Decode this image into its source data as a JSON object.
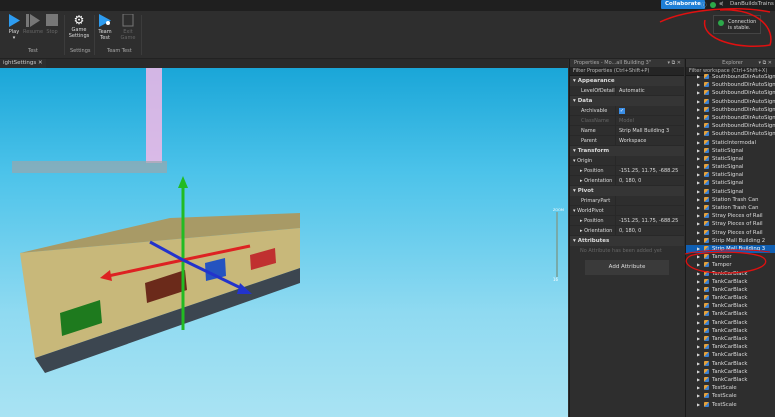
{
  "topbar": {
    "collaborate": "Collaborate",
    "user": "DanBuildsTrains"
  },
  "ribbon": {
    "play": "Play",
    "resume": "Resume",
    "stop": "Stop",
    "game_settings": "Game Settings",
    "team_test": "Team Test",
    "exit_game": "Exit Game",
    "groups": {
      "test": "Test",
      "settings": "Settings",
      "team_test": "Team Test"
    }
  },
  "tab": {
    "label": "ightSettings",
    "close": "✕"
  },
  "toast": {
    "text": "Connection is stable."
  },
  "viewport": {
    "zoom_label": "ZOOM",
    "zoom_value": "16"
  },
  "properties": {
    "title": "Properties - Mo...all Building 3\"",
    "filter": "Filter Properties (Ctrl+Shift+P)",
    "sections": {
      "appearance": "Appearance",
      "data": "Data",
      "transform": "Transform",
      "pivot": "Pivot",
      "attributes": "Attributes"
    },
    "rows": {
      "lod": {
        "k": "LevelOfDetail",
        "v": "Automatic"
      },
      "archivable": {
        "k": "Archivable",
        "v": true
      },
      "classname": {
        "k": "ClassName",
        "v": "Model"
      },
      "name": {
        "k": "Name",
        "v": "Strip Mall Building 3"
      },
      "parent": {
        "k": "Parent",
        "v": "Workspace"
      },
      "origin": {
        "k": "Origin"
      },
      "origin_pos": {
        "k": "Position",
        "v": "-151.25, 11.75, -688.25"
      },
      "origin_ori": {
        "k": "Orientation",
        "v": "0, 180, 0"
      },
      "primarypart": {
        "k": "PrimaryPart",
        "v": ""
      },
      "worldpivot": {
        "k": "WorldPivot"
      },
      "pivot_pos": {
        "k": "Position",
        "v": "-151.25, 11.75, -688.25"
      },
      "pivot_ori": {
        "k": "Orientation",
        "v": "0, 180, 0"
      }
    },
    "no_attr": "No Attribute has been added yet",
    "add_attribute": "Add Attribute"
  },
  "explorer": {
    "title": "Explorer",
    "filter": "Filter workspace (Ctrl+Shift+X)",
    "items": [
      "SouthboundDirAutoSigna",
      "SouthboundDirAutoSigna",
      "SouthboundDirAutoSigna",
      "SouthboundDirAutoSigna",
      "SouthboundDirAutoSigna",
      "SouthboundDirAutoSigna",
      "SouthboundDirAutoSigna",
      "SouthboundDirAutoSigna",
      "StaticIntermodal",
      "StaticSignal",
      "StaticSignal",
      "StaticSignal",
      "StaticSignal",
      "StaticSignal",
      "StaticSignal",
      "Station Trash Can",
      "Station Trash Can",
      "Stray Pieces of Rail",
      "Stray Pieces of Rail",
      "Stray Pieces of Rail",
      "Strip Mall Building 2",
      "Strip Mall Building 3",
      "Tamper",
      "Tamper",
      "TankCarBlack",
      "TankCarBlack",
      "TankCarBlack",
      "TankCarBlack",
      "TankCarBlack",
      "TankCarBlack",
      "TankCarBlack",
      "TankCarBlack",
      "TankCarBlack",
      "TankCarBlack",
      "TankCarBlack",
      "TankCarBlack",
      "TankCarBlack",
      "TankCarBlack",
      "TestScale",
      "TestScale",
      "TestScale"
    ],
    "selected": "Strip Mall Building 3"
  }
}
